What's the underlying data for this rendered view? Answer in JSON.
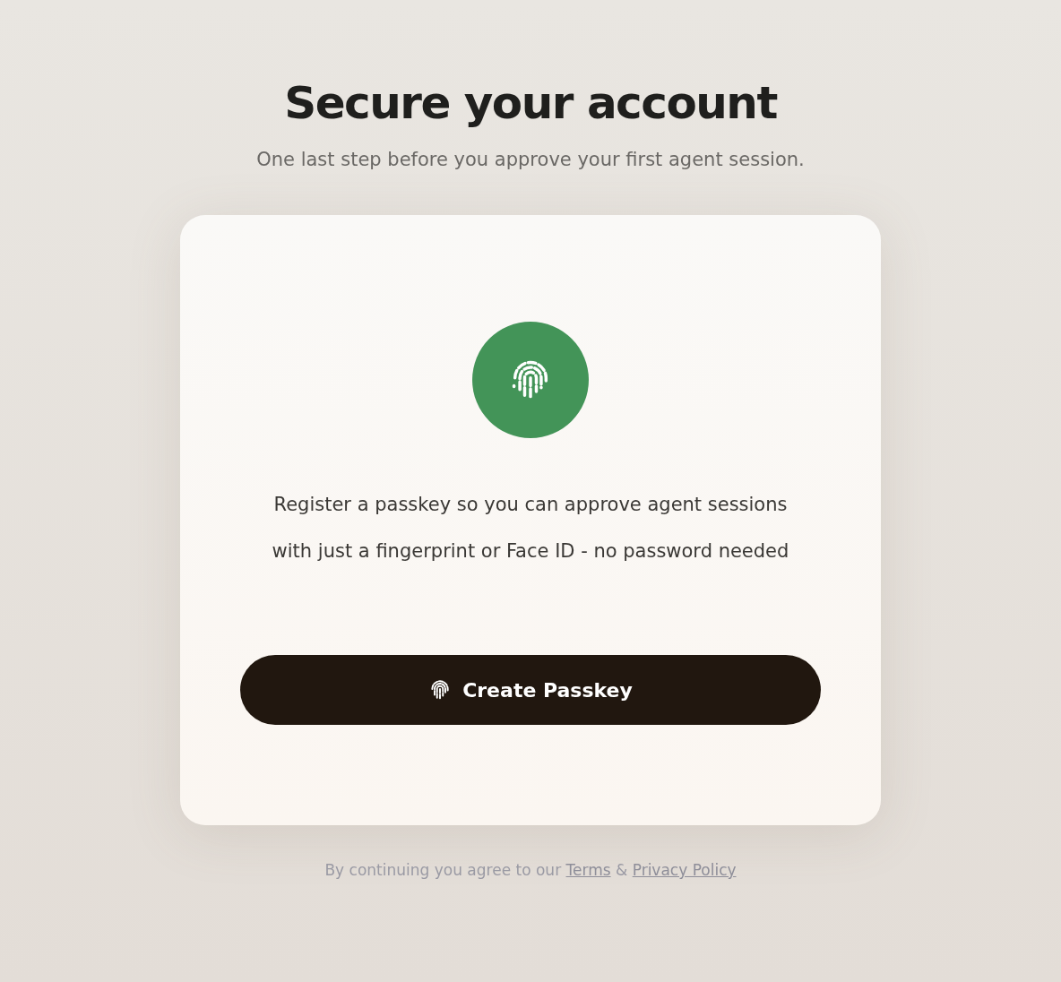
{
  "title": "Secure your account",
  "subtitle": "One last step before you approve your first agent session.",
  "card": {
    "description": "Register a passkey so you can approve agent sessions with just a fingerprint or Face ID - no password needed",
    "button": {
      "label": "Create Passkey"
    }
  },
  "footer": {
    "text": "By continuing you agree to our",
    "terms_link": "Terms",
    "separator": "&",
    "privacy_link": "Privacy Policy"
  }
}
